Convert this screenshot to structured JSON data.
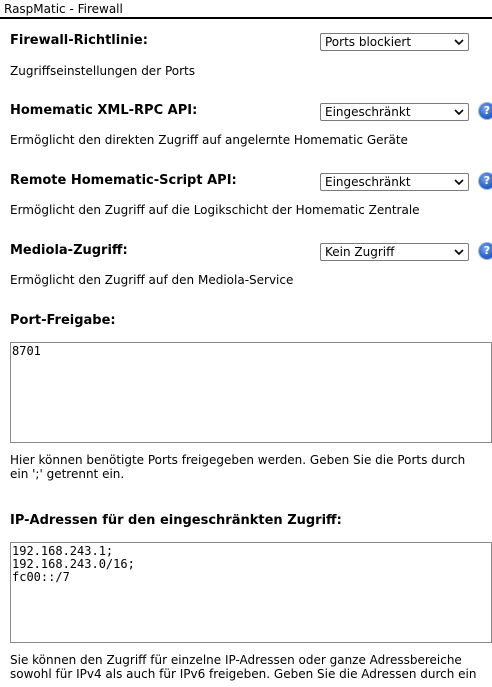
{
  "window": {
    "title": "RaspMatic - Firewall"
  },
  "firewall_policy": {
    "label": "Firewall-Richtlinie:",
    "value": "Ports blockiert",
    "description": "Zugriffseinstellungen der Ports"
  },
  "xmlrpc": {
    "label": "Homematic XML-RPC API:",
    "value": "Eingeschränkt",
    "description": "Ermöglicht den direkten Zugriff auf angelernte Homematic Geräte"
  },
  "script_api": {
    "label": "Remote Homematic-Script API:",
    "value": "Eingeschränkt",
    "description": "Ermöglicht den Zugriff auf die Logikschicht der Homematic Zentrale"
  },
  "mediola": {
    "label": "Mediola-Zugriff:",
    "value": "Kein Zugriff",
    "description": "Ermöglicht den Zugriff auf den Mediola-Service"
  },
  "port_release": {
    "label": "Port-Freigabe:",
    "value": "8701",
    "description": "Hier können benötigte Ports freigegeben werden. Geben Sie die Ports durch ein ';' getrennt ein."
  },
  "ip_restricted": {
    "label": "IP-Adressen für den eingeschränkten Zugriff:",
    "value": "192.168.243.1;\n192.168.243.0/16;\nfc00::/7",
    "description": "Sie können den Zugriff für einzelne IP-Adressen oder ganze Adressbereiche sowohl für IPv4 als auch für IPv6 freigeben. Geben Sie die Adressen durch ein"
  },
  "help_icon_glyph": "?"
}
